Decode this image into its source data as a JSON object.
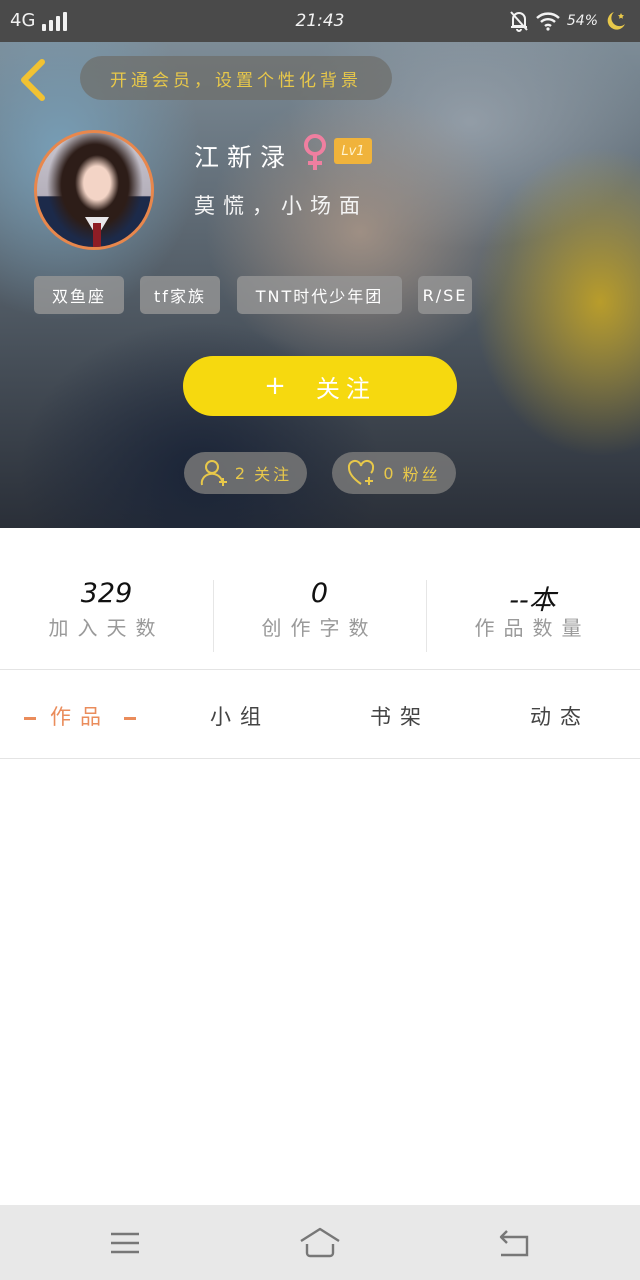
{
  "status_bar": {
    "network": "4G",
    "time": "21:43",
    "battery": "54%"
  },
  "header": {
    "hint": "开通会员，设置个性化背景",
    "username": "江新渌",
    "level": "Lv1",
    "signature": "莫慌，小场面",
    "tags": [
      "双鱼座",
      "tf家族",
      "TNT时代少年团",
      "R/SE"
    ],
    "follow_label": "关注",
    "follow_plus": "+",
    "following": {
      "count": "2",
      "label": "关注"
    },
    "fans": {
      "count": "0",
      "label": "粉丝"
    }
  },
  "stats": [
    {
      "value": "329",
      "label": "加入天数"
    },
    {
      "value": "0",
      "label": "创作字数"
    },
    {
      "value": "--本",
      "label": "作品数量"
    }
  ],
  "tabs": [
    {
      "label": "作品",
      "active": true
    },
    {
      "label": "小组",
      "active": false
    },
    {
      "label": "书架",
      "active": false
    },
    {
      "label": "动态",
      "active": false
    }
  ],
  "colors": {
    "accent_yellow": "#f6d90f",
    "accent_orange": "#ea8c5b",
    "hint_text": "#e8c84a",
    "gender_pink": "#ef7fa0"
  },
  "icons": {
    "back": "chevron-left-icon",
    "gender": "female-icon",
    "following": "user-add-icon",
    "fans": "heart-add-icon",
    "nav_menu": "menu-icon",
    "nav_home": "home-icon",
    "nav_back": "return-icon"
  }
}
